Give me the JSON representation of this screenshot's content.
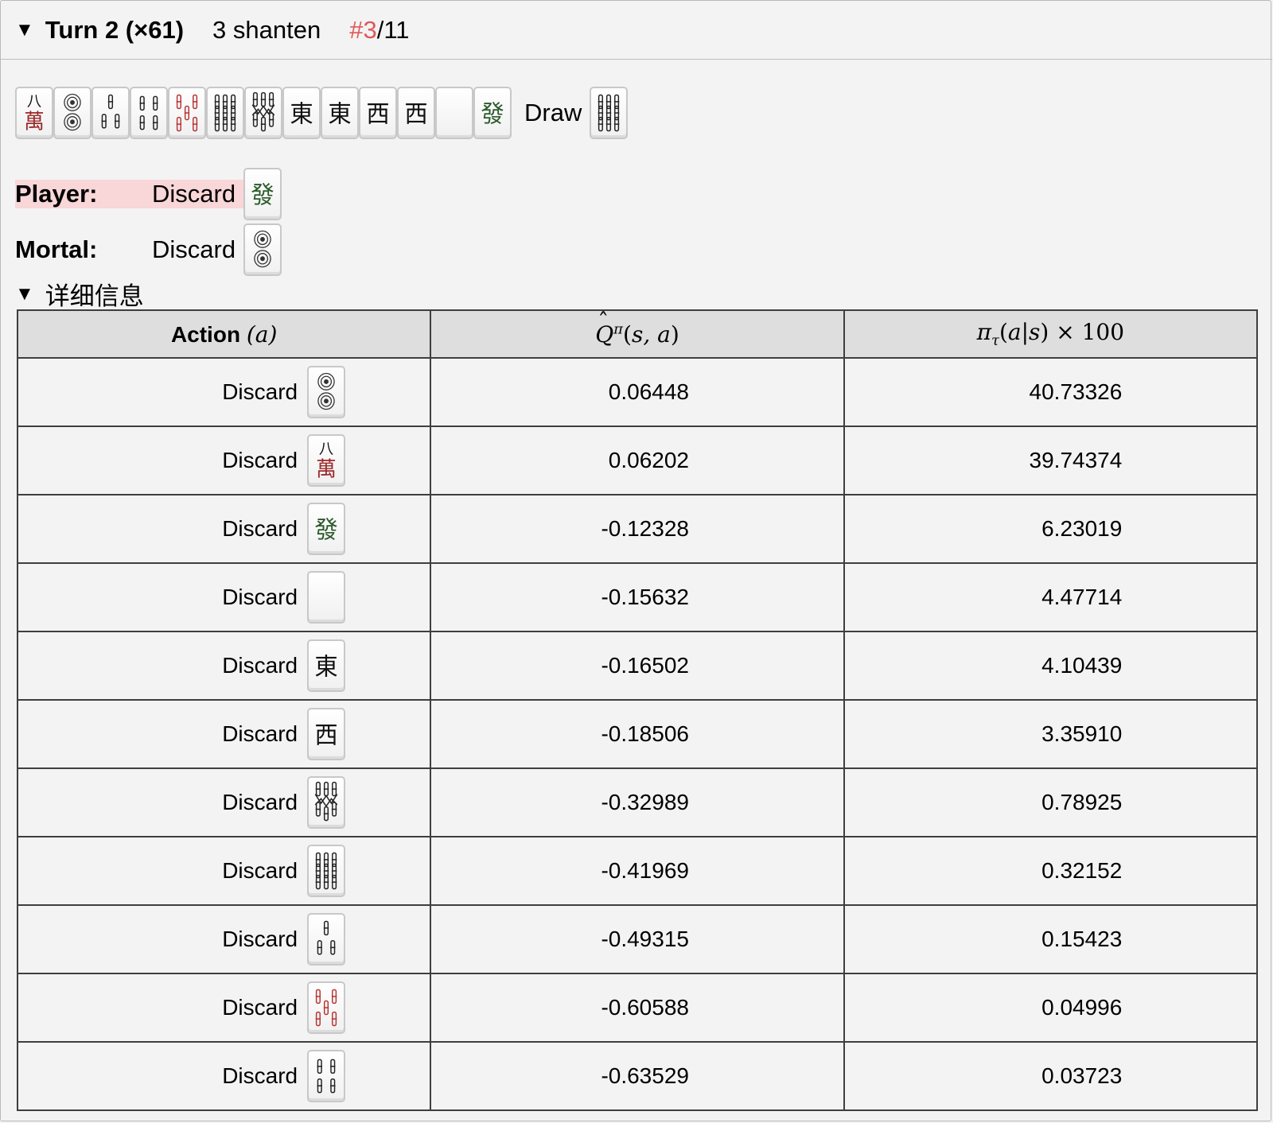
{
  "header": {
    "turn_title": "Turn 2 (×61)",
    "shanten": "3 shanten",
    "rank_current": "#3",
    "rank_total": "/11"
  },
  "hand": {
    "tiles": [
      "8m",
      "2p",
      "3s",
      "4s",
      "5s-red",
      "9s",
      "7s",
      "east",
      "east",
      "west",
      "west",
      "white",
      "green"
    ],
    "draw_label": "Draw",
    "draw_tile": "9s"
  },
  "decision": {
    "player_label": "Player:",
    "player_action": "Discard",
    "player_tile": "green",
    "mortal_label": "Mortal:",
    "mortal_action": "Discard",
    "mortal_tile": "2p"
  },
  "details": {
    "summary": "详细信息",
    "columns": [
      "Action",
      "(a)",
      "Q",
      "π",
      "× 100"
    ],
    "rows": [
      {
        "action": "Discard",
        "tile": "2p",
        "q": "0.06448",
        "pi": "40.73326"
      },
      {
        "action": "Discard",
        "tile": "8m",
        "q": "0.06202",
        "pi": "39.74374"
      },
      {
        "action": "Discard",
        "tile": "green",
        "q": "-0.12328",
        "pi": "6.23019"
      },
      {
        "action": "Discard",
        "tile": "white",
        "q": "-0.15632",
        "pi": "4.47714"
      },
      {
        "action": "Discard",
        "tile": "east",
        "q": "-0.16502",
        "pi": "4.10439"
      },
      {
        "action": "Discard",
        "tile": "west",
        "q": "-0.18506",
        "pi": "3.35910"
      },
      {
        "action": "Discard",
        "tile": "7s",
        "q": "-0.32989",
        "pi": "0.78925"
      },
      {
        "action": "Discard",
        "tile": "9s",
        "q": "-0.41969",
        "pi": "0.32152"
      },
      {
        "action": "Discard",
        "tile": "3s",
        "q": "-0.49315",
        "pi": "0.15423"
      },
      {
        "action": "Discard",
        "tile": "5s-red",
        "q": "-0.60588",
        "pi": "0.04996"
      },
      {
        "action": "Discard",
        "tile": "4s",
        "q": "-0.63529",
        "pi": "0.03723"
      }
    ]
  }
}
